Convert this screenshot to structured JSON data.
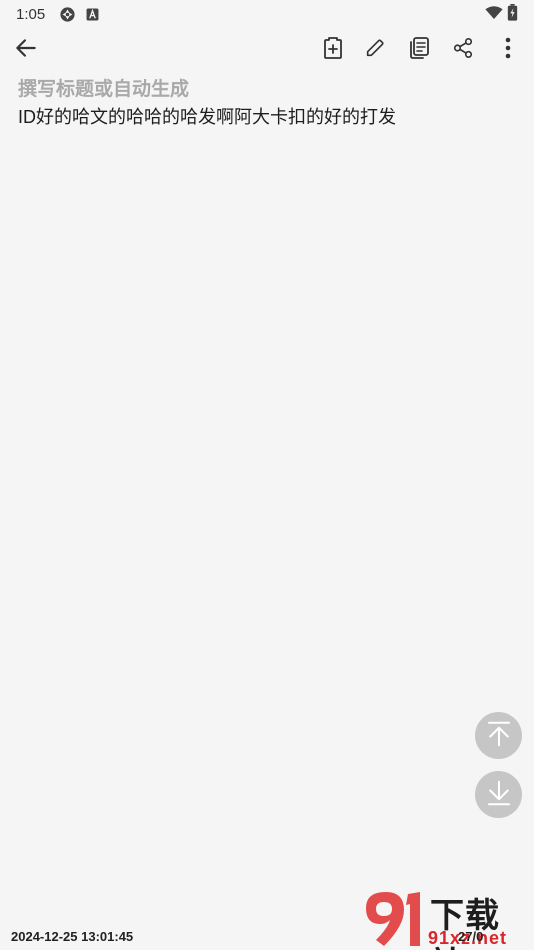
{
  "status_bar": {
    "time": "1:05",
    "icons": [
      "settings-sync-icon",
      "keyboard-a-icon",
      "wifi-icon",
      "battery-icon"
    ]
  },
  "toolbar": {
    "icons": [
      "back-arrow-icon",
      "add-file-icon",
      "edit-pencil-icon",
      "copy-icon",
      "share-icon",
      "more-vert-icon"
    ]
  },
  "note": {
    "title_placeholder": "撰写标题或自动生成",
    "body": "ID好的哈文的哈哈的哈发啊阿大卡扣的好的打发"
  },
  "floating": {
    "scroll_top_icon": "arrow-to-top-icon",
    "scroll_bottom_icon": "arrow-to-bottom-icon"
  },
  "footer": {
    "timestamp": "2024-12-25 13:01:45",
    "char_count": "27/0"
  },
  "watermark": {
    "top": "下载站",
    "bottom": "91xz.net"
  },
  "colors": {
    "background": "#f5f5f5",
    "icon": "#333333",
    "placeholder": "#a9a9a9",
    "fab": "#c6c6c6",
    "watermark_red": "#d8262c"
  }
}
